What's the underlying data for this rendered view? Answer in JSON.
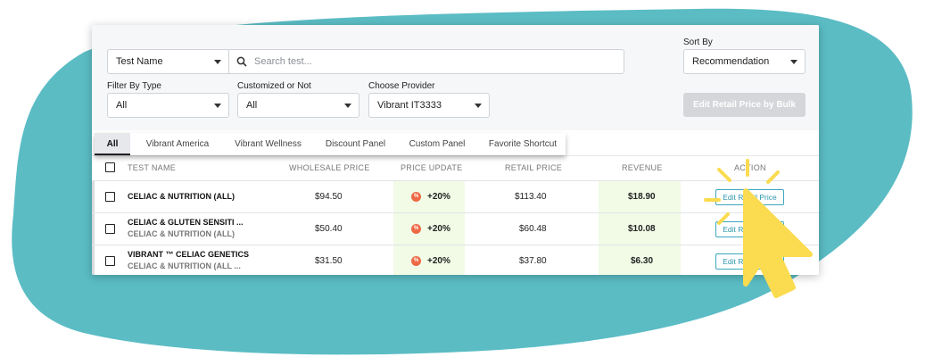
{
  "filters": {
    "test_name_select": "Test Name",
    "search_placeholder": "Search test...",
    "filter_by_type_label": "Filter By Type",
    "filter_by_type_value": "All",
    "customized_label": "Customized or Not",
    "customized_value": "All",
    "provider_label": "Choose Provider",
    "provider_value": "Vibrant IT3333",
    "sort_by_label": "Sort By",
    "sort_by_value": "Recommendation",
    "bulk_button": "Edit Retail Price by Bulk"
  },
  "tabs": [
    {
      "label": "All",
      "active": true
    },
    {
      "label": "Vibrant America",
      "active": false
    },
    {
      "label": "Vibrant Wellness",
      "active": false
    },
    {
      "label": "Discount Panel",
      "active": false
    },
    {
      "label": "Custom Panel",
      "active": false
    },
    {
      "label": "Favorite Shortcut",
      "active": false
    }
  ],
  "table": {
    "headers": {
      "test_name": "TEST NAME",
      "wholesale_price": "WHOLESALE PRICE",
      "price_update": "PRICE UPDATE",
      "retail_price": "RETAIL PRICE",
      "revenue": "REVENUE",
      "action": "ACTION"
    },
    "rows": [
      {
        "name": "CELIAC & NUTRITION (ALL)",
        "subname": "",
        "wholesale": "$94.50",
        "update": "+20%",
        "retail": "$113.40",
        "revenue": "$18.90",
        "action": "Edit Retail Price"
      },
      {
        "name": "CELIAC & GLUTEN SENSITI ...",
        "subname": "CELIAC & NUTRITION (ALL)",
        "wholesale": "$50.40",
        "update": "+20%",
        "retail": "$60.48",
        "revenue": "$10.08",
        "action": "Edit Retail Price"
      },
      {
        "name": "VIBRANT ™ CELIAC GENETICS",
        "subname": "CELIAC & NUTRITION (ALL ...",
        "wholesale": "$31.50",
        "update": "+20%",
        "retail": "$37.80",
        "revenue": "$6.30",
        "action": "Edit Retail Price"
      }
    ],
    "percent_icon_glyph": "%"
  },
  "colors": {
    "background_blob": "#5bbcc4",
    "price_update_bg": "#f1fbe6",
    "revenue_bg": "#f1fbe6",
    "action_border": "#3aa7bd",
    "percent_icon": "#ee6a45",
    "cursor": "#fbdb4f"
  },
  "icons": {
    "search": "magnifier-icon",
    "cursor": "pointer-cursor-icon",
    "click_burst": "click-burst-icon"
  }
}
